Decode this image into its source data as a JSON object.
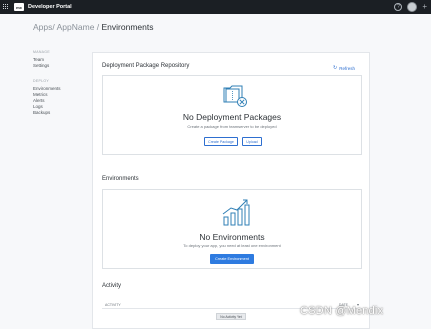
{
  "topbar": {
    "logo_text": "mx",
    "title": "Developer Portal"
  },
  "breadcrumb": {
    "prefix": "Apps/ AppName / ",
    "current": "Environments"
  },
  "sidebar": {
    "groups": [
      {
        "heading": "MANAGE",
        "items": [
          "Team",
          "Settings"
        ]
      },
      {
        "heading": "DEPLOY",
        "items": [
          "Environments",
          "Metrics",
          "Alerts",
          "Logs",
          "Backups"
        ]
      }
    ]
  },
  "deployment": {
    "title": "Deployment Package Repository",
    "refresh_label": "Refresh",
    "empty_title": "No Deployment Packages",
    "empty_sub": "Create a package from teamserver to be deployed",
    "create_label": "Create Package",
    "upload_label": "Upload"
  },
  "environments": {
    "title": "Environments",
    "empty_title": "No Environments",
    "empty_sub": "To deploy your app, you need at least one environment",
    "create_label": "Create Environment"
  },
  "activity": {
    "title": "Activity",
    "col_left": "ACTIVITY",
    "col_right": "DATE",
    "empty_badge": "No Activity Yet"
  },
  "watermark": "CSDN @Mendix",
  "colors": {
    "topbar": "#1b1f24",
    "accent": "#2e7be0",
    "icon": "#2f7fb5"
  }
}
